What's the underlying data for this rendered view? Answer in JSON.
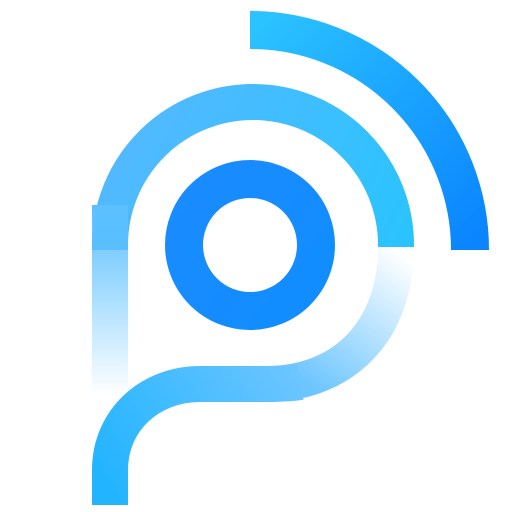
{
  "logo": {
    "icon": "location-signal-icon",
    "colors": {
      "light_blue": "#2BC3FF",
      "mid_blue": "#1E9BFF",
      "deep_blue": "#0A84FF",
      "background": "#FFFFFF"
    }
  }
}
